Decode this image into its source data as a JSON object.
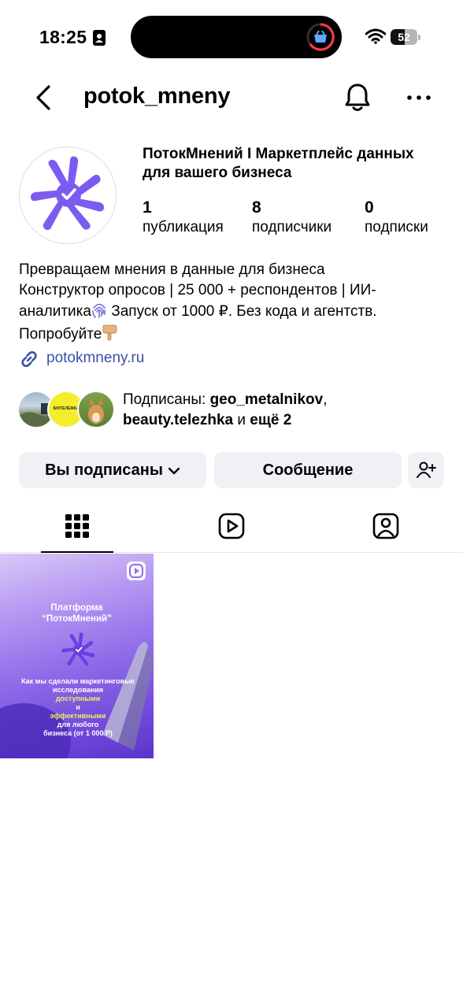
{
  "status_bar": {
    "time": "18:25",
    "battery_level": "52",
    "battery_fraction": 0.52
  },
  "header": {
    "username": "potok_mneny"
  },
  "profile": {
    "display_name_line1": "ПотокМнений I Маркетплейс данных",
    "display_name_line2": "для вашего бизнеса",
    "stats": [
      {
        "value": "1",
        "label": "публикация"
      },
      {
        "value": "8",
        "label": "подписчики"
      },
      {
        "value": "0",
        "label": "подписки"
      }
    ],
    "bio": {
      "line1": "Превращаем мнения в данные для бизнеса",
      "line2": "Конструктор опросов | 25 000 + респондентов | ИИ-",
      "line3_a": "аналитика",
      "line3_b": "Запуск от 1000 ₽. Без кода и агентств.",
      "line4": "Попробуйте"
    },
    "link": "potokmneny.ru",
    "followed_by": {
      "prefix": "Подписаны: ",
      "user1": "geo_metalnikov",
      "sep": ",",
      "user2": "beauty.telezhka",
      "and": " и ",
      "more": "ещё 2",
      "avatar2_text": "БЮТЕЛЕЖКА"
    }
  },
  "actions": {
    "following_label": "Вы подписаны",
    "message_label": "Сообщение"
  },
  "post": {
    "title_line1": "Платформа",
    "title_line2": "“ПотокМнений”",
    "text_line1": "Как мы сделали маркетинговые",
    "text_line2a": "исследования ",
    "text_line2b": "доступными",
    "text_line2c": " и",
    "text_line3a": "эффективными",
    "text_line3b": " для любого",
    "text_line4": "бизнеса (от 1 000 Р)"
  },
  "colors": {
    "brand_purple": "#7b5cf0",
    "link_blue": "#3a4fa8",
    "button_bg": "#eff1f5",
    "highlight_yellow": "#e8f25a"
  },
  "icons": [
    "person-card-icon",
    "shopping-basket-icon",
    "wifi-icon",
    "battery-icon",
    "back-arrow-icon",
    "bell-icon",
    "more-icon",
    "link-icon",
    "fingerprint-emoji",
    "pointing-hand-emoji",
    "chevron-down-icon",
    "add-person-icon",
    "grid-icon",
    "reels-icon",
    "tagged-icon",
    "reel-badge-icon"
  ]
}
